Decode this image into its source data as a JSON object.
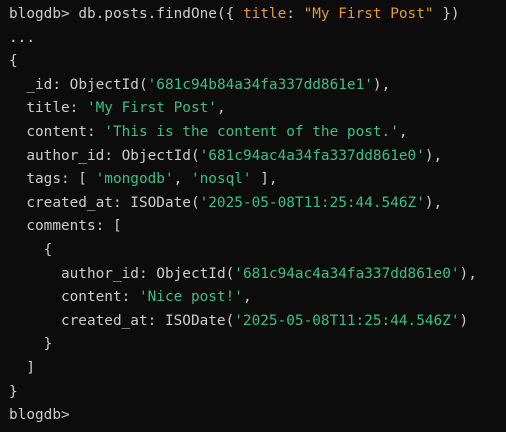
{
  "colors": {
    "background": "#0c0c0c",
    "foreground": "#cccccc",
    "string_orange": "#e39b3a",
    "string_green": "#3bbf8c"
  },
  "command": {
    "prompt": "blogdb> ",
    "text_before": "db.posts.findOne({ ",
    "field": "title",
    "colon": ": ",
    "value": "\"My First Post\"",
    "text_after": " })"
  },
  "continuation": "...",
  "document": {
    "open_brace": "{",
    "id_key": "_id",
    "id_value": "'681c94b84a34fa337dd861e1'",
    "title_key": "title",
    "title_value": "'My First Post'",
    "content_key": "content",
    "content_value": "'This is the content of the post.'",
    "author_key": "author_id",
    "author_value": "'681c94ac4a34fa337dd861e0'",
    "tags_key": "tags",
    "tags": [
      "'mongodb'",
      "'nosql'"
    ],
    "created_key": "created_at",
    "created_value": "'2025-05-08T11:25:44.546Z'",
    "comments_key": "comments",
    "comment": {
      "author_key": "author_id",
      "author_value": "'681c94ac4a34fa337dd861e0'",
      "content_key": "content",
      "content_value": "'Nice post!'",
      "created_key": "created_at",
      "created_value": "'2025-05-08T11:25:44.546Z'"
    },
    "close_brace": "}"
  },
  "final_prompt": "blogdb> "
}
